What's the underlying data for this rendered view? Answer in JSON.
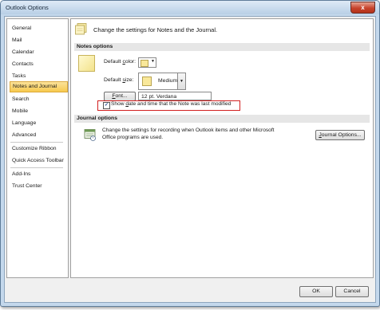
{
  "window": {
    "title": "Outlook Options",
    "close_glyph": "x"
  },
  "nav": {
    "items": [
      {
        "label": "General"
      },
      {
        "label": "Mail"
      },
      {
        "label": "Calendar"
      },
      {
        "label": "Contacts"
      },
      {
        "label": "Tasks"
      },
      {
        "label": "Notes and Journal",
        "selected": true
      },
      {
        "label": "Search"
      },
      {
        "label": "Mobile"
      },
      {
        "label": "Language"
      },
      {
        "label": "Advanced"
      },
      {
        "label": "Customize Ribbon"
      },
      {
        "label": "Quick Access Toolbar"
      },
      {
        "label": "Add-Ins"
      },
      {
        "label": "Trust Center"
      }
    ]
  },
  "header": {
    "text": "Change the settings for Notes and the Journal.",
    "icon": "notes-stack-icon"
  },
  "notes": {
    "section_title": "Notes options",
    "default_color_label": "Default color:",
    "default_size_label": "Default size:",
    "default_size_value": "Medium",
    "font_button": "Font...",
    "font_value": "12 pt. Verdana",
    "checkbox_label": "Show date and time that the Note was last modified",
    "checkbox_checked": true,
    "checkbox_glyph": "✓",
    "note_color": "#f9e89a",
    "highlight_color": "#d21f1f"
  },
  "journal": {
    "section_title": "Journal options",
    "text": "Change the settings for recording when Outlook items and other Microsoft Office programs are used.",
    "button": "Journal Options..."
  },
  "footer": {
    "ok": "OK",
    "cancel": "Cancel"
  }
}
